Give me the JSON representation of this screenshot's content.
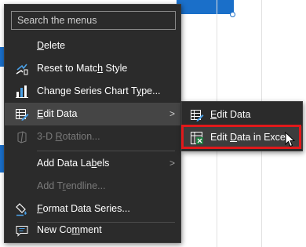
{
  "search": {
    "placeholder": "Search the menus"
  },
  "menu": {
    "delete": {
      "pre": "",
      "acc": "D",
      "post": "elete"
    },
    "reset": {
      "pre": "Reset to Matc",
      "acc": "h",
      "post": " Style"
    },
    "change_type": {
      "pre": "Change Series Chart T",
      "acc": "y",
      "post": "pe..."
    },
    "edit_data": {
      "pre": "",
      "acc": "E",
      "post": "dit Data"
    },
    "rotation": {
      "pre": "3-D ",
      "acc": "R",
      "post": "otation..."
    },
    "add_labels": {
      "pre": "Add Data La",
      "acc": "b",
      "post": "els"
    },
    "add_trendline": {
      "pre": "Add T",
      "acc": "r",
      "post": "endline..."
    },
    "format_series": {
      "pre": "",
      "acc": "F",
      "post": "ormat Data Series..."
    },
    "new_comment": {
      "pre": "New Co",
      "acc": "m",
      "post": "ment"
    },
    "arrow": ">"
  },
  "submenu": {
    "edit_data": {
      "pre": "",
      "acc": "E",
      "post": "dit Data"
    },
    "edit_in_excel": {
      "pre": "Edit ",
      "acc": "D",
      "post": "ata in Excel"
    }
  },
  "colors": {
    "menu_bg": "#2b2b2b",
    "highlight": "#454545",
    "accent_red": "#e0191b",
    "chart_blue": "#1a6fc9"
  }
}
